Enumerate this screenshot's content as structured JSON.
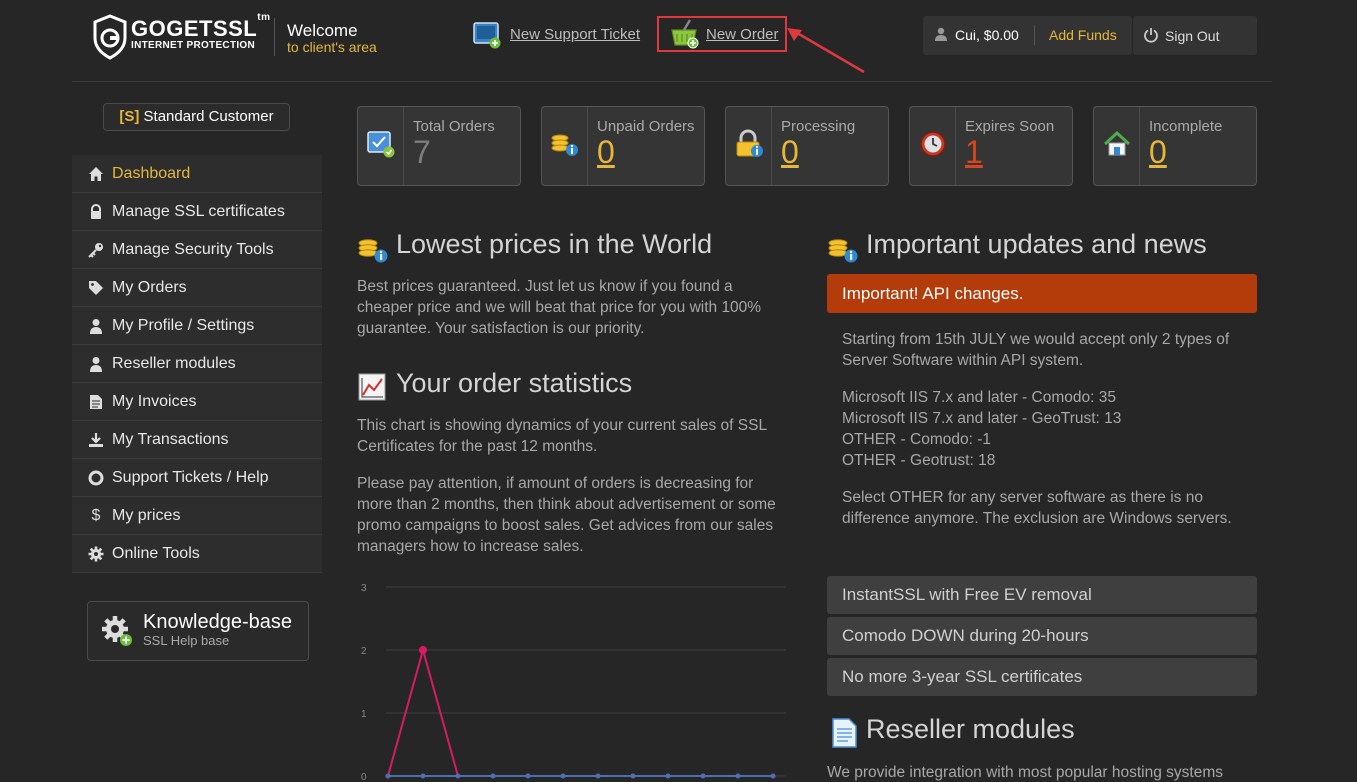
{
  "header": {
    "logo_main": "GOGETSSL",
    "logo_tm": "tm",
    "logo_sub": "INTERNET PROTECTION",
    "welcome_line1": "Welcome",
    "welcome_line2": "to client's area",
    "support_ticket_label": "New Support Ticket",
    "new_order_label": "New Order",
    "user_name": "Cui",
    "balance": "$0.00",
    "add_funds_label": "Add Funds",
    "sign_out_label": "Sign Out"
  },
  "sidebar": {
    "badge_prefix": "[S]",
    "badge_label": "Standard Customer",
    "items": [
      {
        "label": "Dashboard",
        "icon": "home-icon"
      },
      {
        "label": "Manage SSL certificates",
        "icon": "lock-icon"
      },
      {
        "label": "Manage Security Tools",
        "icon": "key-icon"
      },
      {
        "label": "My Orders",
        "icon": "tag-icon"
      },
      {
        "label": "My Profile / Settings",
        "icon": "user-icon"
      },
      {
        "label": "Reseller modules",
        "icon": "user-icon"
      },
      {
        "label": "My Invoices",
        "icon": "document-icon"
      },
      {
        "label": "My Transactions",
        "icon": "download-icon"
      },
      {
        "label": "Support Tickets / Help",
        "icon": "lifebuoy-icon"
      },
      {
        "label": "My prices",
        "icon": "dollar-icon"
      },
      {
        "label": "Online Tools",
        "icon": "gear-icon"
      }
    ],
    "kb_title": "Knowledge-base",
    "kb_sub": "SSL Help base"
  },
  "stats": [
    {
      "label": "Total Orders",
      "value": "7"
    },
    {
      "label": "Unpaid Orders",
      "value": "0"
    },
    {
      "label": "Processing",
      "value": "0"
    },
    {
      "label": "Expires Soon",
      "value": "1"
    },
    {
      "label": "Incomplete",
      "value": "0"
    }
  ],
  "lowest": {
    "title": "Lowest prices in the World",
    "text": "Best prices guaranteed. Just let us know if you found a cheaper price and we will beat that price for you with 100% guarantee. Your satisfaction is our priority."
  },
  "statistics": {
    "title": "Your order statistics",
    "text1": "This chart is showing dynamics of your current sales of SSL Certificates for the past 12 months.",
    "text2": "Please pay attention, if amount of orders is decreasing for more than 2 months, then think about advertisement or some promo campaigns to boost sales. Get advices from our sales managers how to increase sales."
  },
  "chart_data": {
    "type": "line",
    "y_ticks": [
      "0",
      "1",
      "2",
      "3"
    ],
    "ylim": [
      0,
      3
    ],
    "series": [
      {
        "values": [
          0,
          2,
          0,
          0,
          0,
          0,
          0,
          0,
          0,
          0,
          0,
          0
        ],
        "color": "#d81b60"
      },
      {
        "values": [
          0,
          0,
          0,
          0,
          0,
          0,
          0,
          0,
          0,
          0,
          0,
          0
        ],
        "color": "#4a6fb5"
      }
    ]
  },
  "news": {
    "title": "Important updates and news",
    "highlight_label": "Important! API changes.",
    "p1": "Starting from 15th JULY we would accept only 2 types of Server Software within API system.",
    "lines": [
      "Microsoft IIS 7.x and later - Comodo: 35",
      "Microsoft IIS 7.x and later - GeoTrust: 13",
      "OTHER - Comodo: -1",
      "OTHER - Geotrust: 18"
    ],
    "p3": "Select OTHER for any server software as there is no difference anymore. The exclusion are Windows servers.",
    "items": [
      "InstantSSL with Free EV removal",
      "Comodo DOWN during 20-hours",
      "No more 3-year SSL certificates"
    ]
  },
  "reseller": {
    "title": "Reseller modules",
    "text": "We provide integration with most popular hosting systems"
  },
  "colors": {
    "accent": "#e6b73a",
    "alert": "#b43c0a",
    "highlight_box": "#e0383e"
  }
}
